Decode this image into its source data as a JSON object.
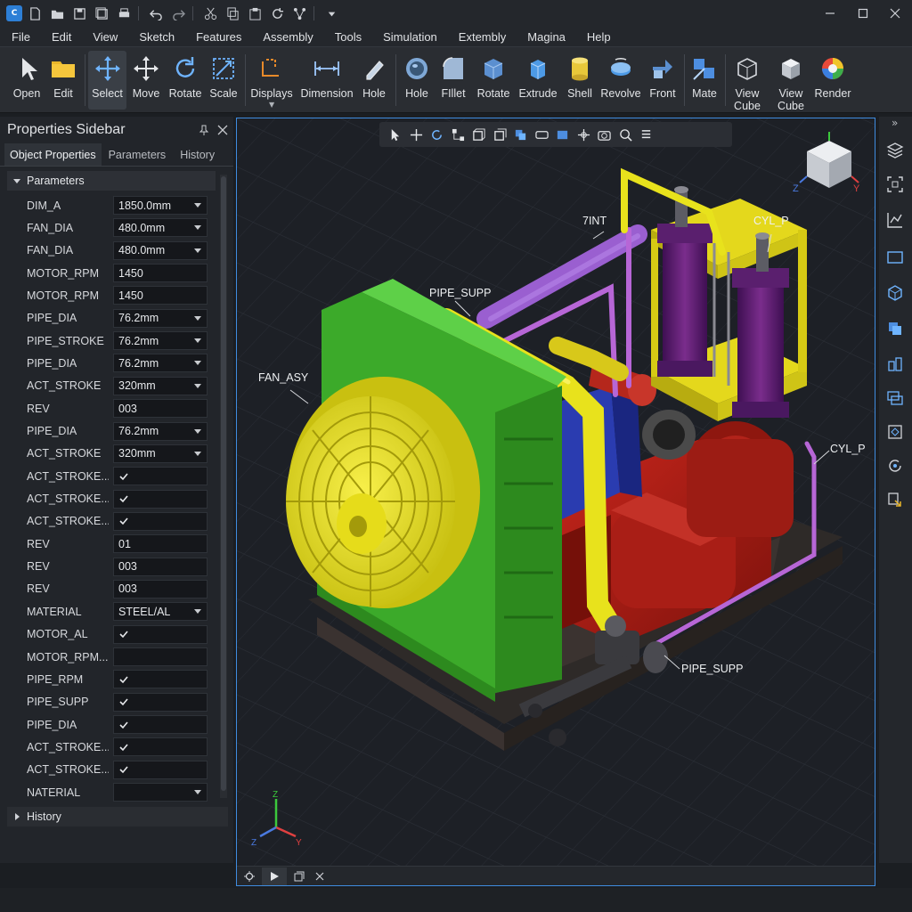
{
  "menu": [
    "File",
    "Edit",
    "View",
    "Sketch",
    "Features",
    "Assembly",
    "Tools",
    "Simulation",
    "Extembly",
    "Magina",
    "Help"
  ],
  "ribbon": {
    "open": "Open",
    "edit": "Edit",
    "select": "Select",
    "move": "Move",
    "rotate": "Rotate",
    "scale": "Scale",
    "displays": "Displays",
    "dimension": "Dimension",
    "hole_sketch": "Hole",
    "hole": "Hole",
    "fillet": "FIllet",
    "rotate_feature": "Rotate",
    "extrude": "Extrude",
    "shell": "Shell",
    "revolve": "Revolve",
    "front": "Front",
    "mate": "Mate",
    "view_cube_1": "View\nCube",
    "view_cube_2": "View\nCube",
    "render": "Render"
  },
  "sidebar": {
    "title": "Properties Sidebar",
    "tabs": [
      "Object Properties",
      "Parameters",
      "History"
    ],
    "section": "Parameters",
    "rows": [
      {
        "label": "DIM_A",
        "value": "1850.0mm",
        "kind": "dropdown"
      },
      {
        "label": "FAN_DIA",
        "value": "480.0mm",
        "kind": "dropdown"
      },
      {
        "label": "FAN_DIA",
        "value": "480.0mm",
        "kind": "dropdown"
      },
      {
        "label": "MOTOR_RPM",
        "value": "1450",
        "kind": "text"
      },
      {
        "label": "MOTOR_RPM",
        "value": "1450",
        "kind": "text"
      },
      {
        "label": "PIPE_DIA",
        "value": "76.2mm",
        "kind": "dropdown"
      },
      {
        "label": "PIPE_STROKE",
        "value": "76.2mm",
        "kind": "dropdown"
      },
      {
        "label": "PIPE_DIA",
        "value": "76.2mm",
        "kind": "dropdown"
      },
      {
        "label": "ACT_STROKE",
        "value": "320mm",
        "kind": "dropdown"
      },
      {
        "label": "REV",
        "value": "003",
        "kind": "text"
      },
      {
        "label": "PIPE_DIA",
        "value": "76.2mm",
        "kind": "dropdown"
      },
      {
        "label": "ACT_STROKE",
        "value": "320mm",
        "kind": "dropdown"
      },
      {
        "label": "ACT_STROKE...",
        "value": "",
        "kind": "check"
      },
      {
        "label": "ACT_STROKE...",
        "value": "",
        "kind": "check"
      },
      {
        "label": "ACT_STROKE...",
        "value": "",
        "kind": "check"
      },
      {
        "label": "REV",
        "value": "01",
        "kind": "text"
      },
      {
        "label": "REV",
        "value": "003",
        "kind": "text"
      },
      {
        "label": "REV",
        "value": "003",
        "kind": "text"
      },
      {
        "label": "MATERIAL",
        "value": "STEEL/AL",
        "kind": "dropdown"
      },
      {
        "label": "MOTOR_AL",
        "value": "",
        "kind": "check"
      },
      {
        "label": "MOTOR_RPM...",
        "value": "",
        "kind": "text"
      },
      {
        "label": "PIPE_RPM",
        "value": "",
        "kind": "check"
      },
      {
        "label": "PIPE_SUPP",
        "value": "",
        "kind": "check"
      },
      {
        "label": "PIPE_DIA",
        "value": "",
        "kind": "check"
      },
      {
        "label": "ACT_STROKE...",
        "value": "",
        "kind": "check"
      },
      {
        "label": "ACT_STROKE...",
        "value": "",
        "kind": "check"
      },
      {
        "label": "NATERIAL",
        "value": "",
        "kind": "dropdown"
      }
    ],
    "history": "History"
  },
  "viewport": {
    "callouts": {
      "fan_asy": "FAN_ASY",
      "pipe_supp_top": "PIPE_SUPP",
      "tint": "7INT",
      "cyl_p_top": "CYL_P",
      "cyl_p_right": "CYL_P",
      "pipe_supp_bottom": "PIPE_SUPP"
    },
    "axis": {
      "x": "X",
      "y": "Y",
      "z": "Z"
    }
  },
  "colors": {
    "accent": "#3f8ce0",
    "frame_green": "#3caa2a",
    "fan_yellow": "#e8e21c",
    "motor_red": "#a81c16",
    "pipe_purple": "#9a5fd0",
    "cylinder_purple": "#5a1f6e",
    "motor_blue": "#2a3cb0"
  }
}
